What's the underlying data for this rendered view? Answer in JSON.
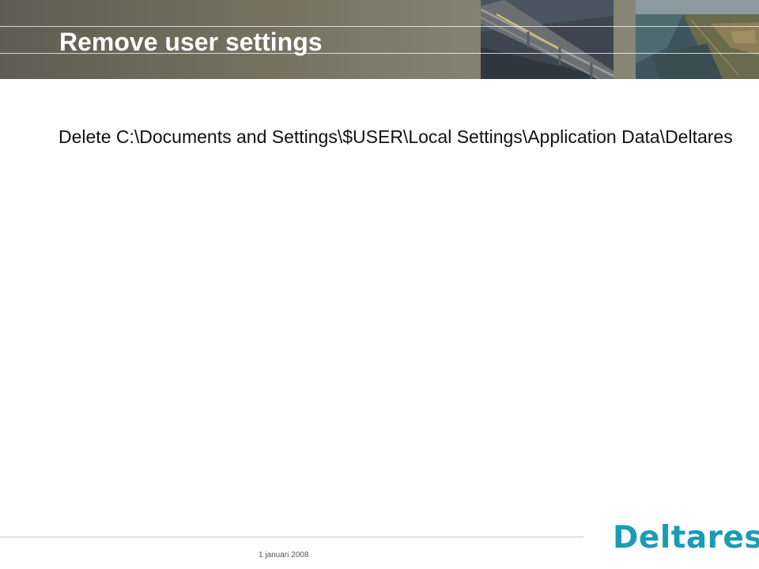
{
  "slide": {
    "title": "Remove user settings",
    "body": "Delete C:\\Documents and Settings\\$USER\\Local Settings\\Application Data\\Deltares"
  },
  "footer": {
    "date": "1 januari 2008",
    "logo": "Deltares"
  },
  "colors": {
    "header_bg": "#7a7866",
    "logo": "#1b9bb5",
    "title": "#ffffff"
  }
}
